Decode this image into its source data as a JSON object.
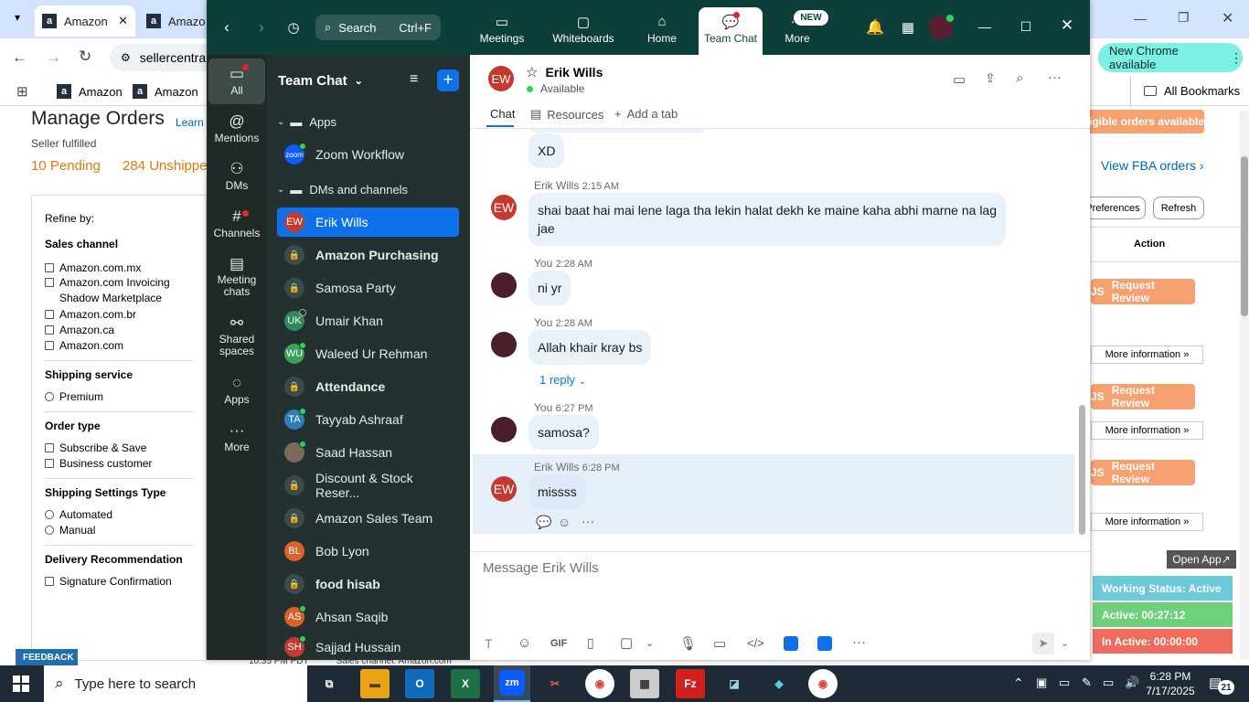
{
  "browser": {
    "tabs": [
      {
        "label": "Amazon"
      },
      {
        "label": "Amazo"
      }
    ],
    "address": "sellercentra",
    "bookmarks": [
      {
        "label": "Amazon"
      },
      {
        "label": "Amazon"
      }
    ],
    "all_bookmarks": "All Bookmarks",
    "new_chrome": "New Chrome available"
  },
  "seller": {
    "title": "Manage Orders",
    "learn": "Learn n",
    "subtitle": "Seller fulfilled",
    "pending": "10 Pending",
    "unshipped": "284 Unshipped",
    "refine_by": "Refine by:",
    "sales_channel": "Sales channel",
    "channels": [
      "Amazon.com.mx",
      "Amazon.com Invoicing Shadow Marketplace",
      "Amazon.com.br",
      "Amazon.ca",
      "Amazon.com"
    ],
    "shipping_service": "Shipping service",
    "premium": "Premium",
    "order_type": "Order type",
    "order_types": [
      "Subscribe & Save",
      "Business customer"
    ],
    "settings_type": "Shipping Settings Type",
    "settings": [
      "Automated",
      "Manual"
    ],
    "delivery": "Delivery Recommendation",
    "signature": "Signature Confirmation",
    "feedback": "FEEDBACK",
    "eligible": "igible orders available",
    "fba": "View FBA orders",
    "preferences": "Preferences",
    "refresh": "Refresh",
    "action": "Action",
    "request_review": "Request Review",
    "more_info": "More information »",
    "open_app": "Open App",
    "status_active": "Working Status: Active",
    "active_time": "Active: 00:27:12",
    "inactive_time": "In Active: 00:00:00",
    "bottom_text1": "10:35 PM PDT",
    "bottom_text2": "Sales channel: Amazon.com",
    "bottom_text3": "ASIN: B003BKV4AC"
  },
  "zoom": {
    "search": "Search",
    "search_shortcut": "Ctrl+F",
    "nav": [
      {
        "label": "Meetings"
      },
      {
        "label": "Whiteboards"
      },
      {
        "label": "Home"
      },
      {
        "label": "Team Chat"
      },
      {
        "label": "More"
      }
    ],
    "new_badge": "NEW",
    "rail": [
      {
        "label": "All"
      },
      {
        "label": "Mentions"
      },
      {
        "label": "DMs"
      },
      {
        "label": "Channels"
      },
      {
        "label": "Meeting chats"
      },
      {
        "label": "Shared spaces"
      },
      {
        "label": "Apps"
      },
      {
        "label": "More"
      }
    ],
    "list_title": "Team Chat",
    "sec_apps": "Apps",
    "zoom_workflow": "Zoom Workflow",
    "sec_dms": "DMs and channels",
    "contacts": [
      {
        "name": "Erik Wills",
        "initials": "EW"
      },
      {
        "name": "Amazon Purchasing"
      },
      {
        "name": "Samosa Party"
      },
      {
        "name": "Umair Khan",
        "initials": "UK"
      },
      {
        "name": "Waleed Ur Rehman",
        "initials": "WU"
      },
      {
        "name": "Attendance"
      },
      {
        "name": "Tayyab Ashraaf",
        "initials": "TA"
      },
      {
        "name": "Saad Hassan"
      },
      {
        "name": "Discount & Stock Reser..."
      },
      {
        "name": "Amazon Sales Team"
      },
      {
        "name": "Bob Lyon",
        "initials": "BL"
      },
      {
        "name": "food hisab"
      },
      {
        "name": "Ahsan Saqib",
        "initials": "AS"
      },
      {
        "name": "Sajjad Hussain",
        "initials": "SH"
      }
    ],
    "chat": {
      "name": "Erik Wills",
      "initials": "EW",
      "status": "Available",
      "tabs": [
        {
          "label": "Chat"
        },
        {
          "label": "Resources"
        },
        {
          "label": "Add a tab"
        }
      ],
      "messages": [
        {
          "text": "XD"
        },
        {
          "sender": "Erik Wills",
          "time": "2:15 AM",
          "text": "shai baat hai mai lene laga tha lekin halat dekh ke maine kaha abhi marne na lag jae"
        },
        {
          "sender": "You",
          "time": "2:28 AM",
          "text": "ni yr"
        },
        {
          "sender": "You",
          "time": "2:28 AM",
          "text": "Allah khair kray bs"
        },
        {
          "sender": "You",
          "time": "6:27 PM",
          "text": "samosa?"
        },
        {
          "sender": "Erik Wills",
          "time": "6:28 PM",
          "text": "missss"
        }
      ],
      "reply": "1 reply",
      "placeholder": "Message Erik Wills",
      "gif": "GIF"
    }
  },
  "taskbar": {
    "search": "Type here to search",
    "time": "6:28 PM",
    "date": "7/17/2025",
    "notif": "21"
  }
}
